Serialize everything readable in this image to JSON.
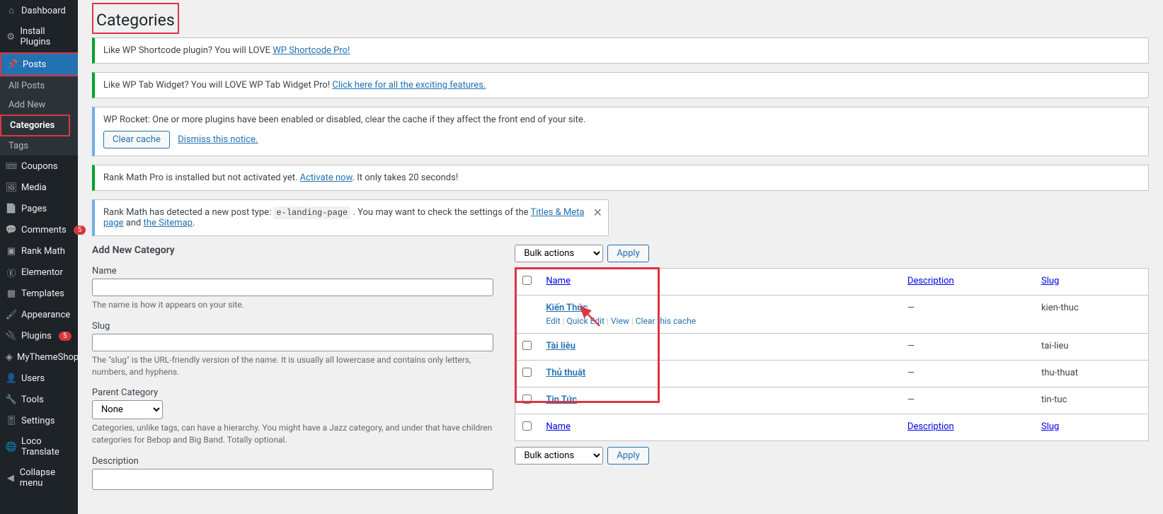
{
  "sidebar": {
    "items": [
      {
        "icon": "dashboard",
        "label": "Dashboard"
      },
      {
        "icon": "gear",
        "label": "Install Plugins"
      },
      {
        "icon": "pin",
        "label": "Posts",
        "active": true
      },
      {
        "icon": "ticket",
        "label": "Coupons"
      },
      {
        "icon": "media",
        "label": "Media"
      },
      {
        "icon": "page",
        "label": "Pages"
      },
      {
        "icon": "comment",
        "label": "Comments",
        "badge": "5"
      },
      {
        "icon": "rank",
        "label": "Rank Math"
      },
      {
        "icon": "elementor",
        "label": "Elementor"
      },
      {
        "icon": "templates",
        "label": "Templates"
      },
      {
        "icon": "brush",
        "label": "Appearance"
      },
      {
        "icon": "plug",
        "label": "Plugins",
        "badge": "5"
      },
      {
        "icon": "theme",
        "label": "MyThemeShop"
      },
      {
        "icon": "user",
        "label": "Users"
      },
      {
        "icon": "wrench",
        "label": "Tools"
      },
      {
        "icon": "sliders",
        "label": "Settings"
      },
      {
        "icon": "loco",
        "label": "Loco Translate"
      },
      {
        "icon": "collapse",
        "label": "Collapse menu"
      }
    ],
    "submenu": [
      {
        "label": "All Posts"
      },
      {
        "label": "Add New"
      },
      {
        "label": "Categories",
        "current": true
      },
      {
        "label": "Tags"
      }
    ]
  },
  "page_title": "Categories",
  "notices": {
    "shortcode": {
      "pre": "Like WP Shortcode plugin? You will LOVE ",
      "link": "WP Shortcode Pro!"
    },
    "tab": {
      "pre": "Like WP Tab Widget? You will LOVE WP Tab Widget Pro! ",
      "link": "Click here for all the exciting features."
    },
    "rocket": {
      "text": "WP Rocket: One or more plugins have been enabled or disabled, clear the cache if they affect the front end of your site.",
      "btn": "Clear cache",
      "dismiss": "Dismiss this notice."
    },
    "rankmath1": {
      "pre": "Rank Math Pro is installed but not activated yet. ",
      "link": "Activate now",
      "post": ". It only takes 20 seconds!"
    },
    "rankmath2": {
      "pre": "Rank Math has detected a new post type: ",
      "code": "e-landing-page",
      "mid": " . You may want to check the settings of the ",
      "link1": "Titles & Meta page",
      "and": " and ",
      "link2": "the Sitemap",
      "post": "."
    }
  },
  "form": {
    "heading": "Add New Category",
    "name_label": "Name",
    "name_desc": "The name is how it appears on your site.",
    "slug_label": "Slug",
    "slug_desc": "The \"slug\" is the URL-friendly version of the name. It is usually all lowercase and contains only letters, numbers, and hyphens.",
    "parent_label": "Parent Category",
    "parent_none": "None",
    "parent_desc": "Categories, unlike tags, can have a hierarchy. You might have a Jazz category, and under that have children categories for Bebop and Big Band. Totally optional.",
    "desc_label": "Description"
  },
  "bulk": {
    "label": "Bulk actions",
    "apply": "Apply"
  },
  "table": {
    "cols": {
      "name": "Name",
      "desc": "Description",
      "slug": "Slug"
    },
    "rows": [
      {
        "name": "Kiến Thức",
        "desc": "—",
        "slug": "kien-thuc",
        "hover": true
      },
      {
        "name": "Tài liệu",
        "desc": "—",
        "slug": "tai-lieu"
      },
      {
        "name": "Thủ thuật",
        "desc": "—",
        "slug": "thu-thuat"
      },
      {
        "name": "Tin Tức",
        "desc": "—",
        "slug": "tin-tuc"
      }
    ],
    "actions": {
      "edit": "Edit",
      "quick": "Quick Edit",
      "view": "View",
      "clear": "Clear this cache"
    }
  }
}
